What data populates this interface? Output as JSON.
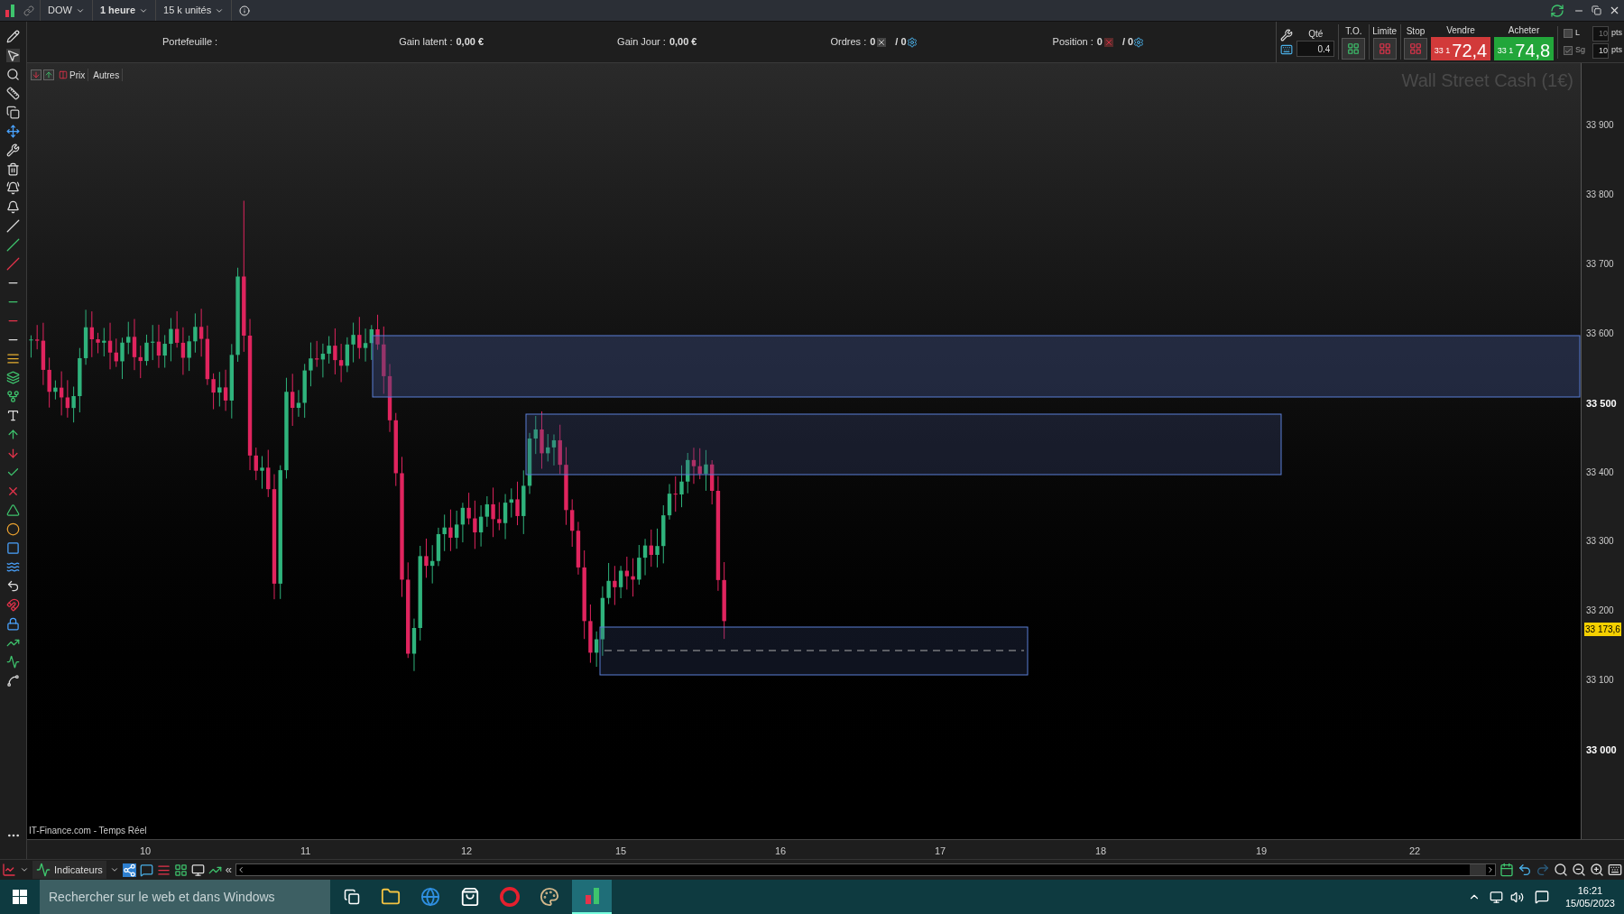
{
  "toolbar": {
    "symbol": "DOW",
    "period": "1 heure",
    "units": "15 k unités"
  },
  "account": {
    "portfolio_label": "Portefeuille :",
    "latent_label": "Gain latent :",
    "latent_value": "0,00 €",
    "day_label": "Gain Jour :",
    "day_value": "0,00 €",
    "orders_label": "Ordres :",
    "orders_count": "0",
    "orders_total": "/ 0",
    "position_label": "Position :",
    "position_count": "0",
    "position_total": "/ 0"
  },
  "order_panel": {
    "qty_label": "Qté",
    "qty_value": "0.4",
    "buttons": [
      "T.O.",
      "Limite",
      "Stop"
    ],
    "sell": {
      "label": "Vendre",
      "prefix": "33 1",
      "price": "72,4"
    },
    "buy": {
      "label": "Acheter",
      "prefix": "33 1",
      "price": "74,8"
    },
    "options": [
      {
        "label": "L",
        "checked": false,
        "value": "10",
        "unit": "pts"
      },
      {
        "label": "Sg",
        "checked": true,
        "value": "10",
        "unit": "pts"
      }
    ]
  },
  "chart": {
    "tabs": [
      "Prix",
      "Autres"
    ],
    "title": "Wall Street Cash (1€)",
    "source": "IT-Finance.com - Temps Réel",
    "price_labels": [
      {
        "label": "33 900",
        "bold": false
      },
      {
        "label": "33 800",
        "bold": false
      },
      {
        "label": "33 700",
        "bold": false
      },
      {
        "label": "33 600",
        "bold": false
      },
      {
        "label": "33 500",
        "bold": true
      },
      {
        "label": "33 400",
        "bold": false
      },
      {
        "label": "33 300",
        "bold": false
      },
      {
        "label": "33 200",
        "bold": false
      },
      {
        "label": "33 100",
        "bold": false
      },
      {
        "label": "33 000",
        "bold": true
      }
    ],
    "current_price": "33 173,6",
    "date_labels": [
      "10",
      "11",
      "12",
      "15",
      "16",
      "17",
      "18",
      "19",
      "22"
    ]
  },
  "bottom_bar": {
    "indicators": "Indicateurs",
    "collapse": "«"
  },
  "taskbar": {
    "search_placeholder": "Rechercher sur le web et dans Windows",
    "time": "16:21",
    "date": "15/05/2023"
  }
}
